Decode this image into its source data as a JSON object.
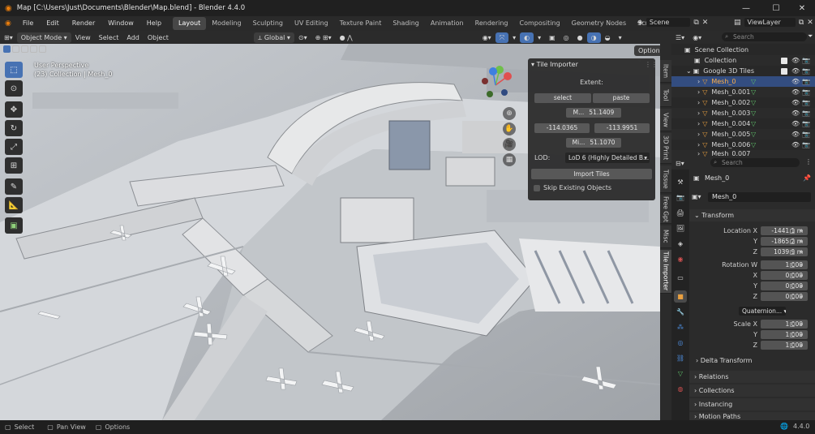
{
  "window": {
    "title": "Map [C:\\Users\\Just\\Documents\\Blender\\Map.blend] - Blender 4.4.0"
  },
  "menu": [
    "File",
    "Edit",
    "Render",
    "Window",
    "Help"
  ],
  "workspaces": [
    "Layout",
    "Modeling",
    "Sculpting",
    "UV Editing",
    "Texture Paint",
    "Shading",
    "Animation",
    "Rendering",
    "Compositing",
    "Geometry Nodes",
    "Scripting"
  ],
  "active_workspace": "Layout",
  "scene": "Scene",
  "view_layer": "ViewLayer",
  "viewport_header": {
    "mode": "Object Mode",
    "menus": [
      "View",
      "Select",
      "Add",
      "Object"
    ],
    "orientation": "Global",
    "options": "Options"
  },
  "viewport_overlay": {
    "perspective": "User Perspective",
    "collection_path": "(23) Collection | Mesh_0"
  },
  "sidebar_tabs": [
    "Item",
    "Tool",
    "View",
    "3D Print",
    "Tissue",
    "Free Gpt",
    "Misc",
    "Tile Importer"
  ],
  "tile_importer": {
    "title": "Tile Importer",
    "extent_label": "Extent:",
    "select_label": "select",
    "paste_label": "paste",
    "max_lat_prefix": "M...",
    "max_lat": "51.1409",
    "min_lon": "-114.0365",
    "max_lon": "-113.9951",
    "min_lat_prefix": "Mi...",
    "min_lat": "51.1070",
    "lod_label": "LOD:",
    "lod_value": "LoD 6 (Highly Detailed B...",
    "import_button": "Import Tiles",
    "skip_existing": "Skip Existing Objects"
  },
  "outliner": {
    "search_placeholder": "Search",
    "rows": [
      {
        "label": "Scene Collection",
        "indent": 0
      },
      {
        "label": "Collection",
        "indent": 1
      },
      {
        "label": "Google 3D Tiles",
        "indent": 1
      },
      {
        "label": "Mesh_0",
        "indent": 2,
        "selected": true
      },
      {
        "label": "Mesh_0.001",
        "indent": 2
      },
      {
        "label": "Mesh_0.002",
        "indent": 2
      },
      {
        "label": "Mesh_0.003",
        "indent": 2
      },
      {
        "label": "Mesh_0.004",
        "indent": 2
      },
      {
        "label": "Mesh_0.005",
        "indent": 2
      },
      {
        "label": "Mesh_0.006",
        "indent": 2
      },
      {
        "label": "Mesh_0.007",
        "indent": 2
      }
    ]
  },
  "properties": {
    "search_placeholder": "Search",
    "object_name": "Mesh_0",
    "data_name": "Mesh_0",
    "transform_label": "Transform",
    "location": {
      "label": "Location X",
      "x": "-1441.1 m",
      "y": "-1865.2 m",
      "z": "1039.9 m"
    },
    "rotation": {
      "label": "Rotation W",
      "w": "1.000",
      "x": "0.000",
      "y": "0.000",
      "z": "0.000"
    },
    "mode_label": "Mode",
    "mode_value": "Quaternion...",
    "scale": {
      "label": "Scale X",
      "x": "1.000",
      "y": "1.000",
      "z": "1.000"
    },
    "axis_y": "Y",
    "axis_z": "Z",
    "axis_x": "X",
    "delta_transform": "Delta Transform",
    "sections": [
      "Relations",
      "Collections",
      "Instancing",
      "Motion Paths"
    ]
  },
  "statusbar": {
    "select": "Select",
    "pan": "Pan View",
    "options": "Options",
    "version": "4.4.0"
  },
  "colors": {
    "accent": "#4772b3",
    "selected_row": "#334d80",
    "mesh_orange": "#e9a040",
    "mesh_green": "#5fbf6a"
  }
}
